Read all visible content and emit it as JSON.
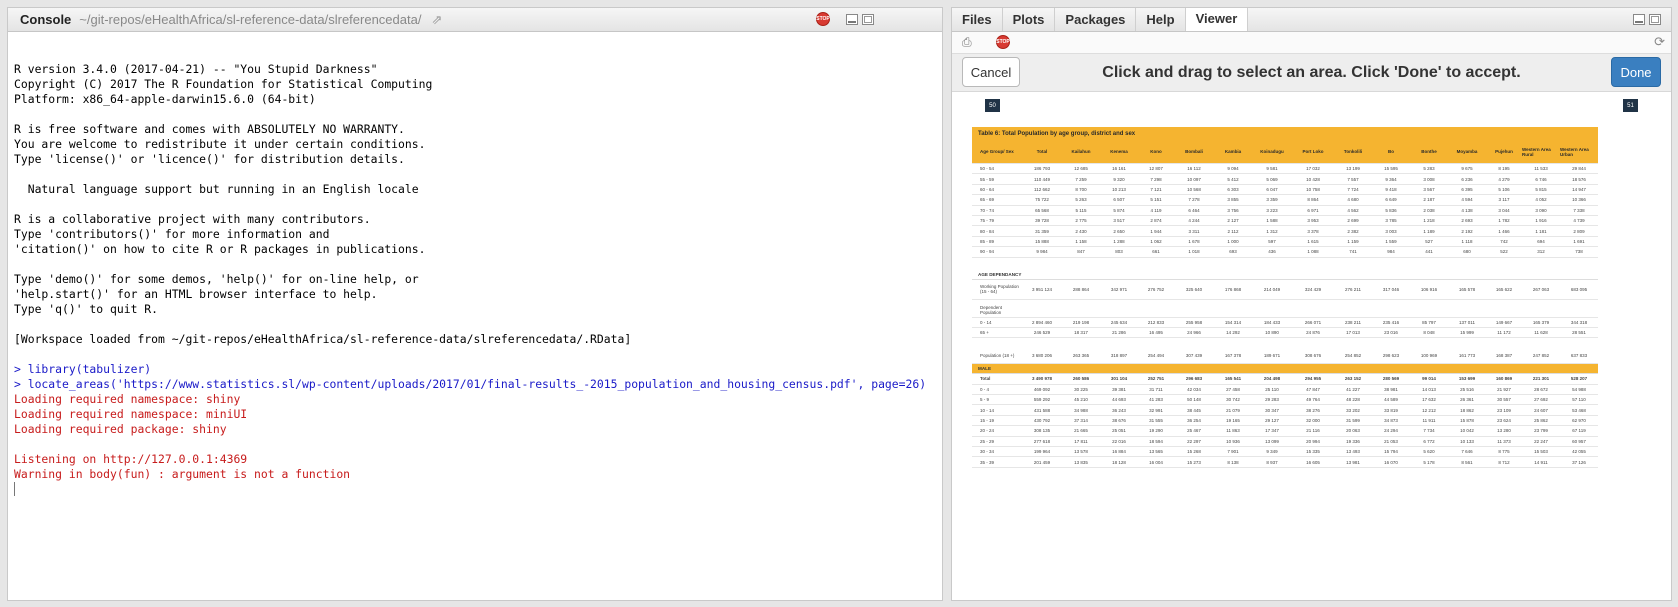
{
  "console": {
    "title": "Console",
    "path": "~/git-repos/eHealthAfrica/sl-reference-data/slreferencedata/",
    "lines": [
      {
        "t": "R version 3.4.0 (2017-04-21) -- \"You Stupid Darkness\"",
        "k": "out"
      },
      {
        "t": "Copyright (C) 2017 The R Foundation for Statistical Computing",
        "k": "out"
      },
      {
        "t": "Platform: x86_64-apple-darwin15.6.0 (64-bit)",
        "k": "out"
      },
      {
        "t": "",
        "k": "out"
      },
      {
        "t": "R is free software and comes with ABSOLUTELY NO WARRANTY.",
        "k": "out"
      },
      {
        "t": "You are welcome to redistribute it under certain conditions.",
        "k": "out"
      },
      {
        "t": "Type 'license()' or 'licence()' for distribution details.",
        "k": "out"
      },
      {
        "t": "",
        "k": "out"
      },
      {
        "t": "  Natural language support but running in an English locale",
        "k": "out"
      },
      {
        "t": "",
        "k": "out"
      },
      {
        "t": "R is a collaborative project with many contributors.",
        "k": "out"
      },
      {
        "t": "Type 'contributors()' for more information and",
        "k": "out"
      },
      {
        "t": "'citation()' on how to cite R or R packages in publications.",
        "k": "out"
      },
      {
        "t": "",
        "k": "out"
      },
      {
        "t": "Type 'demo()' for some demos, 'help()' for on-line help, or",
        "k": "out"
      },
      {
        "t": "'help.start()' for an HTML browser interface to help.",
        "k": "out"
      },
      {
        "t": "Type 'q()' to quit R.",
        "k": "out"
      },
      {
        "t": "",
        "k": "out"
      },
      {
        "t": "[Workspace loaded from ~/git-repos/eHealthAfrica/sl-reference-data/slreferencedata/.RData]",
        "k": "out"
      },
      {
        "t": "",
        "k": "out"
      },
      {
        "t": "> library(tabulizer)",
        "k": "cmd"
      },
      {
        "t": "> locate_areas('https://www.statistics.sl/wp-content/uploads/2017/01/final-results_-2015_population_and_housing_census.pdf', page=26)",
        "k": "cmd"
      },
      {
        "t": "Loading required namespace: shiny",
        "k": "err"
      },
      {
        "t": "Loading required namespace: miniUI",
        "k": "err"
      },
      {
        "t": "Loading required package: shiny",
        "k": "err"
      },
      {
        "t": "",
        "k": "out"
      },
      {
        "t": "Listening on http://127.0.0.1:4369",
        "k": "err"
      },
      {
        "t": "Warning in body(fun) : argument is not a function",
        "k": "err"
      }
    ]
  },
  "right_tabs": [
    "Files",
    "Plots",
    "Packages",
    "Help",
    "Viewer"
  ],
  "active_tab": "Viewer",
  "viewer": {
    "cancel_label": "Cancel",
    "done_label": "Done",
    "message": "Click and drag to select an area. Click 'Done' to accept.",
    "page_left": "50",
    "page_right": "51"
  },
  "pdf": {
    "table_title": "Table 6: Total Population by age group, district and sex",
    "headers": [
      "Age Group/ Sex",
      "Total",
      "Kailahun",
      "Kenema",
      "Kono",
      "Bombali",
      "Kambia",
      "Koinadugu",
      "Port Loko",
      "Tonkolili",
      "Bo",
      "Bonthe",
      "Moyamba",
      "Pujehun",
      "Western Area Rural",
      "Western Area Urban"
    ],
    "rows_top": [
      [
        "50 - 54",
        "186 793",
        "12 685",
        "16 161",
        "12 807",
        "16 112",
        "9 094",
        "9 581",
        "17 032",
        "13 199",
        "15 595",
        "5 283",
        "9 675",
        "8 195",
        "11 533",
        "29 844"
      ],
      [
        "55 - 59",
        "110 449",
        "7 259",
        "9 320",
        "7 298",
        "10 097",
        "5 412",
        "5 069",
        "10 428",
        "7 557",
        "9 364",
        "3 008",
        "6 236",
        "4 279",
        "6 746",
        "18 576"
      ],
      [
        "60 - 64",
        "112 662",
        "8 700",
        "10 213",
        "7 121",
        "10 568",
        "6 303",
        "6 047",
        "10 758",
        "7 724",
        "9 418",
        "3 567",
        "6 395",
        "5 106",
        "5 815",
        "14 947"
      ],
      [
        "65 - 69",
        "75 722",
        "5 263",
        "6 507",
        "5 151",
        "7 278",
        "3 855",
        "3 359",
        "8 864",
        "4 680",
        "6 649",
        "2 187",
        "4 594",
        "3 117",
        "4 052",
        "10 366"
      ],
      [
        "70 - 74",
        "65 568",
        "5 115",
        "5 874",
        "4 119",
        "6 464",
        "3 756",
        "3 223",
        "6 971",
        "4 562",
        "5 836",
        "2 038",
        "4 138",
        "3 044",
        "3 090",
        "7 338"
      ],
      [
        "75 - 79",
        "39 728",
        "2 775",
        "3 517",
        "2 874",
        "4 244",
        "2 127",
        "1 588",
        "3 953",
        "2 699",
        "3 785",
        "1 218",
        "2 693",
        "1 782",
        "1 916",
        "4 739"
      ],
      [
        "80 - 84",
        "31 359",
        "2 430",
        "2 650",
        "1 944",
        "3 311",
        "2 112",
        "1 312",
        "3 378",
        "2 382",
        "3 003",
        "1 189",
        "2 192",
        "1 466",
        "1 181",
        "2 809"
      ],
      [
        "85 - 89",
        "15 888",
        "1 158",
        "1 288",
        "1 062",
        "1 678",
        "1 000",
        "597",
        "1 615",
        "1 159",
        "1 559",
        "527",
        "1 118",
        "742",
        "694",
        "1 691"
      ],
      [
        "90 - 94",
        "9 984",
        "847",
        "803",
        "661",
        "1 018",
        "693",
        "436",
        "1 088",
        "741",
        "984",
        "441",
        "680",
        "522",
        "312",
        "738"
      ]
    ],
    "age_dependency_label": "AGE DEPENDANCY",
    "working_label": "Working Population (15 - 64)",
    "working_values": [
      "3 951 124",
      "288 864",
      "342 971",
      "276 752",
      "325 640",
      "176 868",
      "214 049",
      "324 429",
      "276 211",
      "317 046",
      "106 916",
      "165 578",
      "165 622",
      "267 063",
      "683 095"
    ],
    "dependent_label": "Dependent Population",
    "dep_rows": [
      [
        "0 - 14",
        "2 894 460",
        "219 198",
        "245 634",
        "212 833",
        "255 958",
        "154 314",
        "184 433",
        "266 071",
        "238 211",
        "235 416",
        "85 797",
        "137 011",
        "149 667",
        "165 379",
        "344 318"
      ],
      [
        "65 +",
        "246 529",
        "18 317",
        "21 286",
        "16 495",
        "24 966",
        "14 292",
        "10 890",
        "24 876",
        "17 013",
        "23 016",
        "8 048",
        "15 999",
        "11 172",
        "11 628",
        "28 551"
      ]
    ],
    "pop18_label": "Population (18 +)",
    "pop18_values": [
      "3 680 206",
      "263 365",
      "318 897",
      "254 494",
      "307 439",
      "167 378",
      "189 671",
      "308 676",
      "254 852",
      "298 623",
      "100 969",
      "161 773",
      "168 387",
      "247 852",
      "637 833"
    ],
    "male_label": "MALE",
    "male_rows": [
      [
        "Total",
        "3 490 978",
        "260 586",
        "301 104",
        "252 751",
        "296 683",
        "165 541",
        "204 498",
        "294 955",
        "263 152",
        "280 569",
        "99 014",
        "153 699",
        "160 869",
        "221 301",
        "528 207"
      ],
      [
        "0 - 4",
        "469 092",
        "30 225",
        "39 381",
        "31 711",
        "42 034",
        "27 458",
        "25 110",
        "47 847",
        "41 227",
        "38 981",
        "14 013",
        "25 516",
        "21 927",
        "28 672",
        "54 988"
      ],
      [
        "5 - 9",
        "559 292",
        "45 210",
        "44 693",
        "41 283",
        "50 148",
        "30 742",
        "29 283",
        "49 764",
        "48 228",
        "44 589",
        "17 632",
        "26 361",
        "30 557",
        "27 692",
        "57 110"
      ],
      [
        "10 - 14",
        "431 588",
        "34 988",
        "36 243",
        "32 991",
        "38 445",
        "21 079",
        "30 347",
        "38 276",
        "33 202",
        "33 819",
        "12 212",
        "18 862",
        "23 109",
        "24 607",
        "53 468"
      ],
      [
        "15 - 19",
        "430 792",
        "37 314",
        "38 676",
        "31 555",
        "36 254",
        "19 165",
        "29 127",
        "32 000",
        "31 599",
        "34 873",
        "11 911",
        "15 878",
        "23 624",
        "25 862",
        "62 970"
      ],
      [
        "20 - 24",
        "308 135",
        "21 665",
        "25 051",
        "19 290",
        "25 467",
        "11 863",
        "17 347",
        "21 116",
        "20 063",
        "24 294",
        "7 734",
        "10 042",
        "13 280",
        "23 799",
        "67 119"
      ],
      [
        "25 - 29",
        "277 618",
        "17 811",
        "22 016",
        "18 594",
        "22 297",
        "10 936",
        "13 099",
        "20 994",
        "19 336",
        "21 053",
        "6 772",
        "10 133",
        "11 373",
        "22 247",
        "60 957"
      ],
      [
        "30 - 34",
        "199 964",
        "13 578",
        "16 884",
        "13 565",
        "15 268",
        "7 901",
        "9 349",
        "15 335",
        "13 493",
        "15 794",
        "5 620",
        "7 646",
        "8 775",
        "15 503",
        "42 055"
      ],
      [
        "35 - 39",
        "201 459",
        "13 835",
        "18 128",
        "16 004",
        "15 273",
        "8 138",
        "8 937",
        "16 605",
        "13 981",
        "16 070",
        "5 178",
        "8 561",
        "8 712",
        "14 911",
        "37 126"
      ]
    ]
  }
}
